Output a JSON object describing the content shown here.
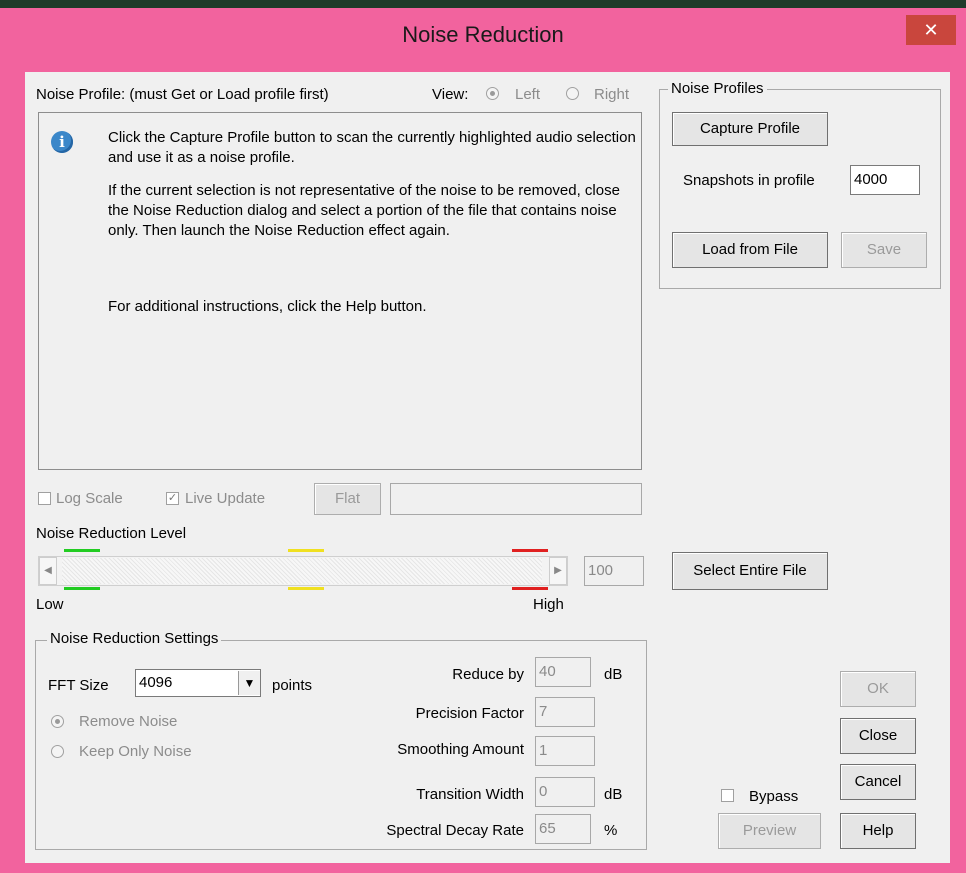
{
  "window": {
    "title": "Noise Reduction",
    "close_glyph": "✕"
  },
  "profile_view": {
    "heading": "Noise Profile: (must Get or Load profile first)",
    "view_label": "View:",
    "left_label": "Left",
    "right_label": "Right",
    "selected": "Left"
  },
  "info": {
    "icon": "info-icon",
    "para1": "Click the Capture Profile button to scan the currently highlighted audio selection and use it as a noise profile.",
    "para2": "If the current selection is not representative of the noise to be removed, close the Noise Reduction dialog and select a portion of the file that contains noise only.  Then launch the Noise Reduction effect again.",
    "para3": "For additional instructions, click the Help button."
  },
  "graph_controls": {
    "log_scale_label": "Log Scale",
    "log_scale_checked": false,
    "live_update_label": "Live Update",
    "live_update_checked": true,
    "flat_label": "Flat",
    "field_value": ""
  },
  "level": {
    "label": "Noise Reduction Level",
    "value": "100",
    "low_label": "Low",
    "high_label": "High",
    "left_arrow": "◀",
    "right_arrow": "▶",
    "marker_colors": [
      "#22cc22",
      "#f0e020",
      "#e02020"
    ]
  },
  "noise_profiles": {
    "group_label": "Noise Profiles",
    "capture_label": "Capture Profile",
    "snapshots_label": "Snapshots in profile",
    "snapshots_value": "4000",
    "load_label": "Load from File",
    "save_label": "Save"
  },
  "select_entire_label": "Select Entire File",
  "settings": {
    "group_label": "Noise Reduction Settings",
    "fft_label": "FFT Size",
    "fft_value": "4096",
    "fft_unit": "points",
    "remove_noise_label": "Remove Noise",
    "keep_only_noise_label": "Keep Only Noise",
    "selected_mode": "Remove Noise",
    "reduce_by_label": "Reduce by",
    "reduce_by_value": "40",
    "reduce_by_unit": "dB",
    "precision_label": "Precision Factor",
    "precision_value": "7",
    "smoothing_label": "Smoothing Amount",
    "smoothing_value": "1",
    "transition_label": "Transition Width",
    "transition_value": "0",
    "transition_unit": "dB",
    "decay_label": "Spectral Decay Rate",
    "decay_value": "65",
    "decay_unit": "%"
  },
  "buttons": {
    "ok": "OK",
    "close": "Close",
    "cancel": "Cancel",
    "help": "Help",
    "preview": "Preview",
    "bypass_label": "Bypass",
    "bypass_checked": false
  }
}
